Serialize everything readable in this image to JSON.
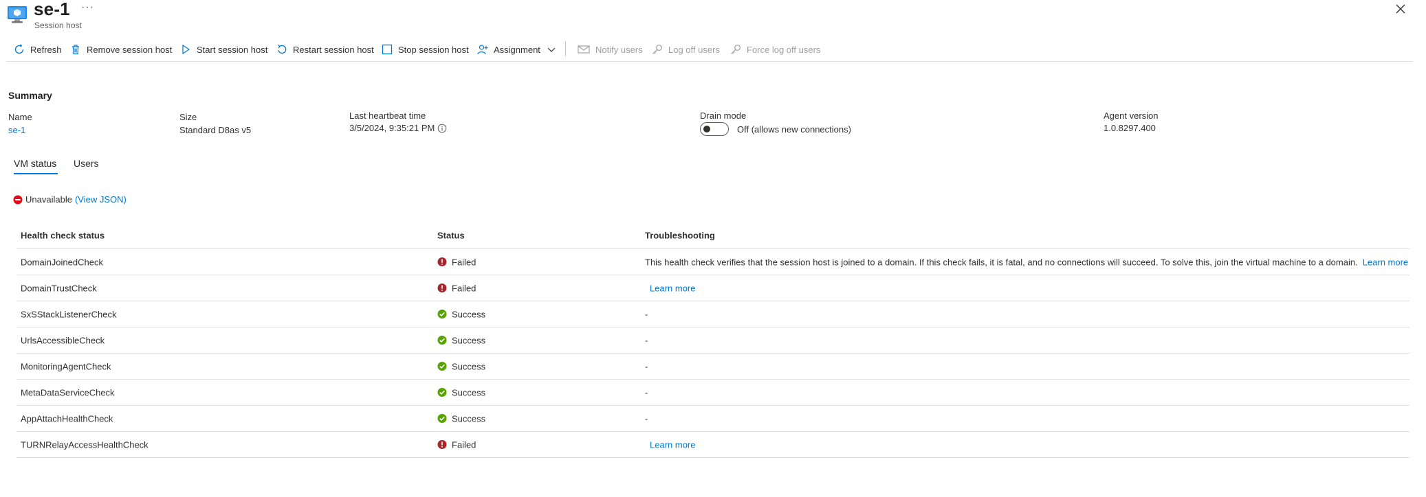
{
  "header": {
    "title": "se-1",
    "ellipsis": "···",
    "subtitle": "Session host"
  },
  "toolbar": {
    "refresh": "Refresh",
    "remove": "Remove session host",
    "start": "Start session host",
    "restart": "Restart session host",
    "stop": "Stop session host",
    "assignment": "Assignment",
    "notify": "Notify users",
    "logoff": "Log off users",
    "force_logoff": "Force log off users"
  },
  "summary": {
    "heading": "Summary",
    "name_label": "Name",
    "name_value": "se-1",
    "size_label": "Size",
    "size_value": "Standard D8as v5",
    "heartbeat_label": "Last heartbeat time",
    "heartbeat_value": "3/5/2024, 9:35:21 PM",
    "drain_label": "Drain mode",
    "drain_value": "Off (allows new connections)",
    "agent_label": "Agent version",
    "agent_value": "1.0.8297.400"
  },
  "tabs": [
    {
      "label": "VM status",
      "active": true
    },
    {
      "label": "Users",
      "active": false
    }
  ],
  "vm_status": {
    "state": "Unavailable",
    "view_json": "(View JSON)"
  },
  "table": {
    "headers": [
      "Health check status",
      "Status",
      "Troubleshooting"
    ],
    "rows": [
      {
        "check": "DomainJoinedCheck",
        "status": "Failed",
        "trouble": "This health check verifies that the session host is joined to a domain. If this check fails, it is fatal, and no connections will succeed. To solve this, join the virtual machine to a domain.",
        "link": "Learn more"
      },
      {
        "check": "DomainTrustCheck",
        "status": "Failed",
        "trouble": "",
        "link": "Learn more"
      },
      {
        "check": "SxSStackListenerCheck",
        "status": "Success",
        "trouble": "-",
        "link": ""
      },
      {
        "check": "UrlsAccessibleCheck",
        "status": "Success",
        "trouble": "-",
        "link": ""
      },
      {
        "check": "MonitoringAgentCheck",
        "status": "Success",
        "trouble": "-",
        "link": ""
      },
      {
        "check": "MetaDataServiceCheck",
        "status": "Success",
        "trouble": "-",
        "link": ""
      },
      {
        "check": "AppAttachHealthCheck",
        "status": "Success",
        "trouble": "-",
        "link": ""
      },
      {
        "check": "TURNRelayAccessHealthCheck",
        "status": "Failed",
        "trouble": "",
        "link": "Learn more"
      }
    ]
  },
  "colors": {
    "accent": "#0078d4",
    "failed": "#a4262c",
    "success": "#57a300",
    "error_icon": "#e00b1c"
  }
}
